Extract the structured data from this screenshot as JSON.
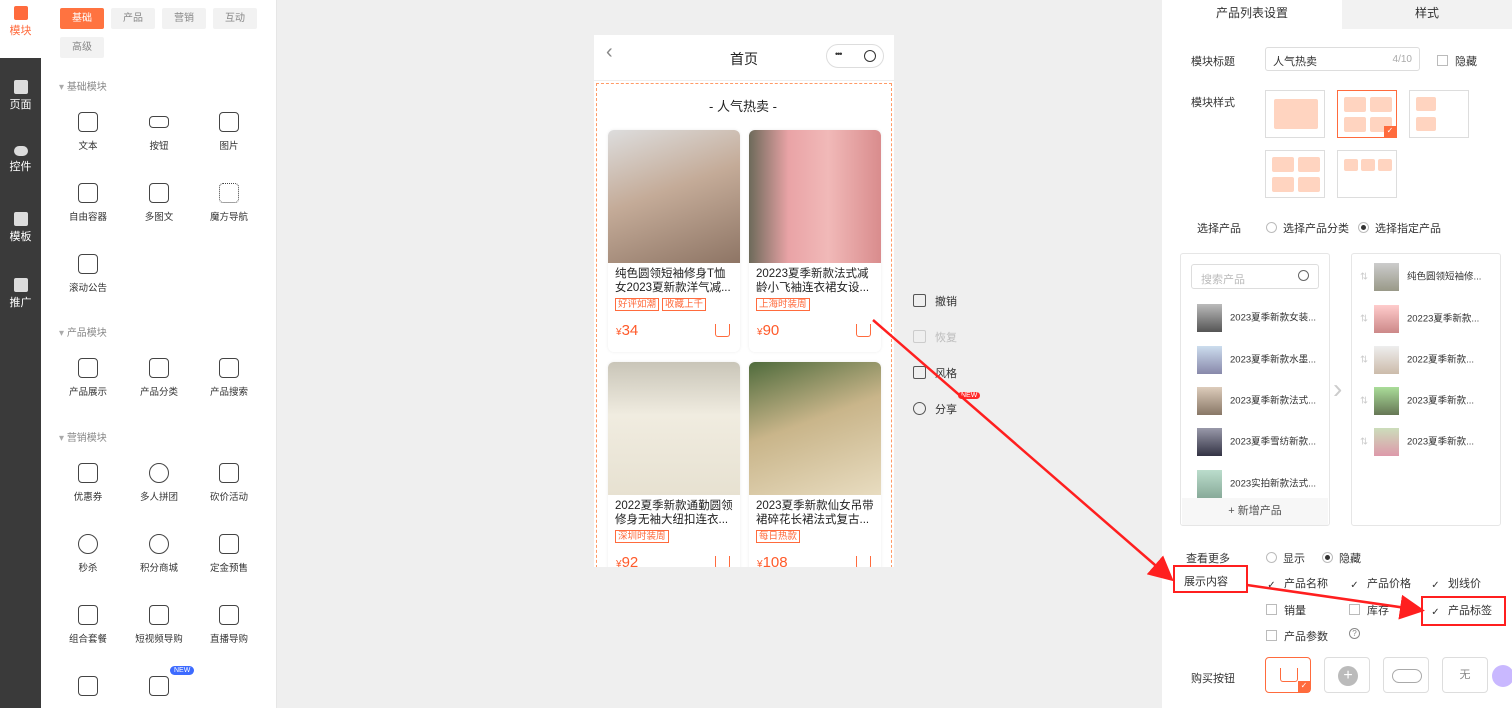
{
  "rail": {
    "items": [
      {
        "label": "模块"
      },
      {
        "label": "页面"
      },
      {
        "label": "控件"
      },
      {
        "label": "模板"
      },
      {
        "label": "推广"
      }
    ]
  },
  "panel": {
    "tabs": [
      "基础",
      "产品",
      "营销",
      "互动",
      "高级"
    ],
    "sections": [
      {
        "title": "基础模块",
        "items": [
          "文本",
          "按钮",
          "图片",
          "自由容器",
          "多图文",
          "魔方导航",
          "滚动公告"
        ]
      },
      {
        "title": "产品模块",
        "items": [
          "产品展示",
          "产品分类",
          "产品搜索"
        ]
      },
      {
        "title": "营销模块",
        "items": [
          "优惠券",
          "多人拼团",
          "砍价活动",
          "秒杀",
          "积分商城",
          "定金预售",
          "组合套餐",
          "短视频导购",
          "直播导购"
        ]
      }
    ],
    "new_badge": "NEW"
  },
  "phone": {
    "title": "首页",
    "back": "‹",
    "menu_dots": "•••",
    "module_title": "- 人气热卖 -",
    "products": [
      {
        "name": "纯色圆领短袖修身T恤女2023夏新款洋气减...",
        "tags": [
          "好评如潮",
          "收藏上千"
        ],
        "currency": "¥",
        "price": "34"
      },
      {
        "name": "20223夏季新款法式减龄小飞袖连衣裙女设...",
        "tags": [
          "上海时装周"
        ],
        "currency": "¥",
        "price": "90"
      },
      {
        "name": "2022夏季新款通勤圆领修身无袖大纽扣连衣...",
        "tags": [
          "深圳时装周"
        ],
        "currency": "¥",
        "price": "92"
      },
      {
        "name": "2023夏季新款仙女吊带裙碎花长裙法式复古...",
        "tags": [
          "每日热款"
        ],
        "currency": "¥",
        "price": "108"
      }
    ]
  },
  "float": {
    "undo": "撤销",
    "redo": "恢复",
    "style": "风格",
    "share": "分享",
    "new": "NEW"
  },
  "right": {
    "tabs": [
      "产品列表设置",
      "样式"
    ],
    "title_label": "模块标题",
    "title_value": "人气热卖",
    "title_count": "4/10",
    "hide": "隐藏",
    "style_label": "模块样式",
    "select_label": "选择产品",
    "select_by_category": "选择产品分类",
    "select_specific": "选择指定产品",
    "search_placeholder": "搜索产品",
    "left_list": [
      "2023夏季新款女装...",
      "2023夏季新款水墨...",
      "2023夏季新款法式...",
      "2023夏季雪纺新款...",
      "2023实拍新款法式..."
    ],
    "add_product": "+ 新增产品",
    "right_list": [
      "纯色圆领短袖修...",
      "20223夏季新款...",
      "2022夏季新款...",
      "2023夏季新款...",
      "2023夏季新款..."
    ],
    "more_label": "查看更多",
    "show": "显示",
    "hide2": "隐藏",
    "content_label": "展示内容",
    "content_opts": [
      {
        "label": "产品名称",
        "on": true
      },
      {
        "label": "产品价格",
        "on": true
      },
      {
        "label": "划线价",
        "on": true
      },
      {
        "label": "销量",
        "on": false
      },
      {
        "label": "库存",
        "on": false
      },
      {
        "label": "产品标签",
        "on": true
      },
      {
        "label": "产品参数",
        "on": false
      }
    ],
    "help": "?",
    "buy_label": "购买按钮",
    "buy_none": "无"
  },
  "colors": {
    "accent": "#ff6b3d",
    "annotation": "#ff1f1f"
  }
}
